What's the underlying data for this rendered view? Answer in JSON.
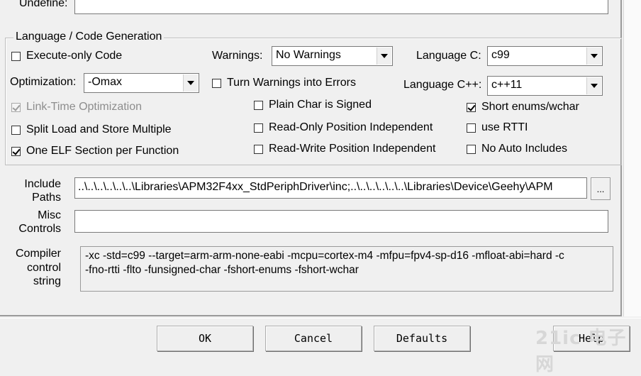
{
  "top": {
    "undefine_label": "Undefine:",
    "undefine_value": ""
  },
  "language_group": {
    "title": "Language / Code Generation",
    "execute_only": {
      "label": "Execute-only Code",
      "checked": false
    },
    "warnings": {
      "label": "Warnings:",
      "value": "No Warnings"
    },
    "language_c": {
      "label": "Language C:",
      "value": "c99"
    },
    "optimization": {
      "label": "Optimization:",
      "value": "-Omax"
    },
    "turn_warnings": {
      "label": "Turn Warnings into Errors",
      "checked": false
    },
    "language_cpp": {
      "label": "Language C++:",
      "value": "c++11"
    },
    "lto": {
      "label": "Link-Time Optimization",
      "checked": true,
      "disabled": true
    },
    "plain_char": {
      "label": "Plain Char is Signed",
      "checked": false
    },
    "short_enums": {
      "label": "Short enums/wchar",
      "checked": true
    },
    "split_load": {
      "label": "Split Load and Store Multiple",
      "checked": false
    },
    "ropi": {
      "label": "Read-Only Position Independent",
      "checked": false
    },
    "rtti": {
      "label": "use RTTI",
      "checked": false
    },
    "one_elf": {
      "label": "One ELF Section per Function",
      "checked": true
    },
    "rwpi": {
      "label": "Read-Write Position Independent",
      "checked": false
    },
    "no_auto_includes": {
      "label": "No Auto Includes",
      "checked": false
    }
  },
  "include": {
    "label_line1": "Include",
    "label_line2": "Paths",
    "value": "..\\..\\..\\..\\..\\..\\Libraries\\APM32F4xx_StdPeriphDriver\\inc;..\\..\\..\\..\\..\\..\\Libraries\\Device\\Geehy\\APM",
    "browse_label": "..."
  },
  "misc": {
    "label_line1": "Misc",
    "label_line2": "Controls",
    "value": ""
  },
  "compiler": {
    "label_line1": "Compiler",
    "label_line2": "control",
    "label_line3": "string",
    "line1": "-xc -std=c99 --target=arm-arm-none-eabi -mcpu=cortex-m4 -mfpu=fpv4-sp-d16 -mfloat-abi=hard -c",
    "line2": "-fno-rtti -flto -funsigned-char -fshort-enums -fshort-wchar"
  },
  "buttons": {
    "ok": "OK",
    "cancel": "Cancel",
    "defaults": "Defaults",
    "help": "Help"
  },
  "watermark": {
    "text": "21ic 电子网"
  }
}
